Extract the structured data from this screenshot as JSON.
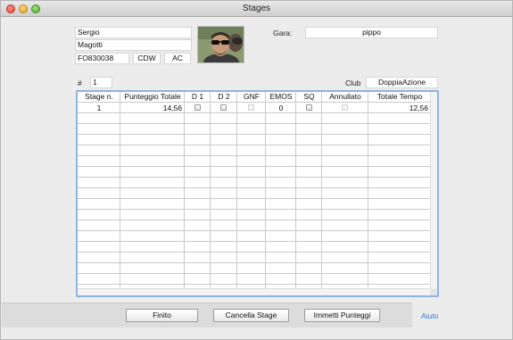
{
  "window": {
    "title": "Stages"
  },
  "shooter": {
    "first_name": "Sergio",
    "last_name": "Magotti",
    "code": "FO830038",
    "division": "CDW",
    "category": "AC"
  },
  "gara": {
    "label": "Gara:",
    "value": "pippo"
  },
  "entry": {
    "label": "#",
    "value": "1"
  },
  "club": {
    "label": "Club",
    "value": "DoppiaAzione"
  },
  "table": {
    "headers": [
      "Stage n.",
      "Punteggio Totale",
      "D 1",
      "D 2",
      "GNF",
      "EMOS",
      "SQ",
      "Annullato",
      "Totale Tempo"
    ],
    "rows": [
      {
        "stage": "1",
        "punteggio": "14,56",
        "d1": false,
        "d2": false,
        "gnf": false,
        "emos": "0",
        "sq": false,
        "annullato": false,
        "tempo": "12,56"
      }
    ]
  },
  "buttons": {
    "finito": "Finito",
    "cancella": "Cancella Stage",
    "immetti": "Immetti Punteggi",
    "aiuto": "Aiuto"
  },
  "colors": {
    "accent": "#8fb2e3",
    "link": "#2a74d8"
  }
}
